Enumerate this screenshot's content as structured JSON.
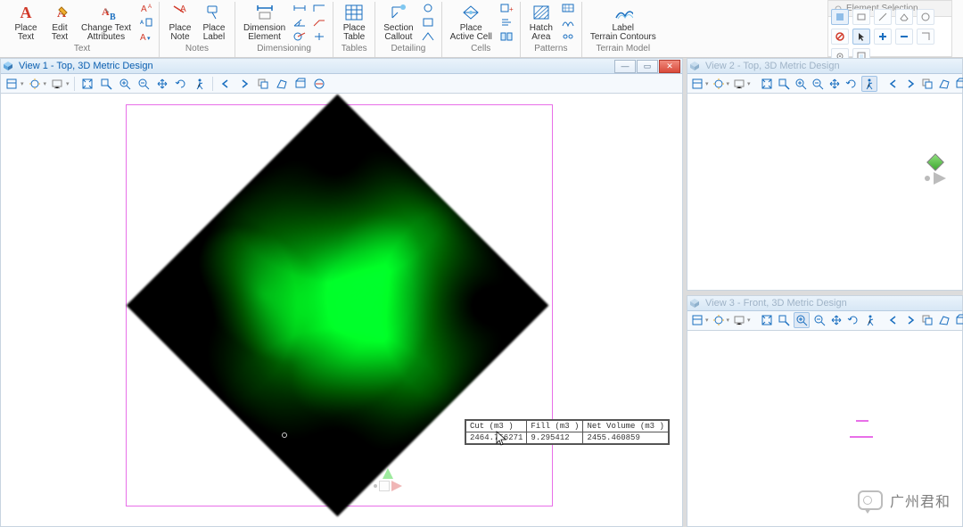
{
  "ribbon": {
    "groups": [
      {
        "label": "Text",
        "buttons": [
          {
            "name": "place-text",
            "label": "Place\nText",
            "icon": "text-A-red"
          },
          {
            "name": "edit-text",
            "label": "Edit\nText",
            "icon": "text-pencil"
          },
          {
            "name": "change-text-attributes",
            "label": "Change Text\nAttributes",
            "icon": "text-swap"
          }
        ],
        "minis": [
          "superscript-icon",
          "text-style-icon",
          "text-case-icon"
        ]
      },
      {
        "label": "Notes",
        "buttons": [
          {
            "name": "place-note",
            "label": "Place\nNote",
            "icon": "note-arrow"
          },
          {
            "name": "place-label",
            "label": "Place\nLabel",
            "icon": "label-tag"
          }
        ]
      },
      {
        "label": "Dimensioning",
        "buttons": [
          {
            "name": "dimension-element",
            "label": "Dimension\nElement",
            "icon": "dim-element"
          }
        ],
        "minis": [
          "dim-linear-icon",
          "dim-angle-icon",
          "dim-radius-icon",
          "dim-ordinate-icon",
          "dim-leader-icon",
          "dim-center-icon"
        ]
      },
      {
        "label": "Tables",
        "buttons": [
          {
            "name": "place-table",
            "label": "Place\nTable",
            "icon": "table-grid"
          }
        ]
      },
      {
        "label": "Detailing",
        "buttons": [
          {
            "name": "section-callout",
            "label": "Section\nCallout",
            "icon": "section-callout"
          }
        ],
        "minis": [
          "detail-a-icon",
          "detail-b-icon",
          "detail-c-icon"
        ]
      },
      {
        "label": "Cells",
        "buttons": [
          {
            "name": "place-active-cell",
            "label": "Place\nActive Cell",
            "icon": "place-cell"
          }
        ],
        "minis": [
          "cell-define-icon",
          "cell-replace-icon",
          "cell-lib-icon"
        ]
      },
      {
        "label": "Patterns",
        "buttons": [
          {
            "name": "hatch-area",
            "label": "Hatch\nArea",
            "icon": "hatch"
          }
        ],
        "minis": [
          "pattern-a-icon",
          "pattern-b-icon",
          "pattern-c-icon"
        ]
      },
      {
        "label": "Terrain Model",
        "buttons": [
          {
            "name": "label-terrain-contours",
            "label": "Label\nTerrain Contours",
            "icon": "terrain-contours"
          }
        ]
      }
    ]
  },
  "palette": {
    "title": "Element Selection",
    "buttons": [
      "select-icon",
      "select-rect-icon",
      "select-line-icon",
      "select-shape-icon",
      "select-circle-icon",
      "select-block-icon",
      "select-stop-icon",
      "cursor-icon",
      "add-sel-icon",
      "subtract-sel-icon",
      "invert-sel-icon",
      "sel-options-icon",
      "sel-filter-icon"
    ]
  },
  "views": {
    "view1": {
      "title": "View 1 - Top, 3D Metric Design"
    },
    "view2": {
      "title": "View 2 - Top, 3D Metric Design"
    },
    "view3": {
      "title": "View 3 - Front, 3D Metric Design"
    }
  },
  "toolbar_icons": [
    "view-attrs",
    "view-display",
    "view-presentation",
    "zoom-fit",
    "zoom-window",
    "zoom-in",
    "zoom-out",
    "pan",
    "rotate-view",
    "walk",
    "prev-view",
    "next-view",
    "copy-view",
    "view-perspective",
    "clip-volume",
    "clip-mask"
  ],
  "volume_table": {
    "headers": [
      "Cut (m3 )",
      "Fill (m3 )",
      "Net Volume (m3 )"
    ],
    "row": [
      "2464.756271",
      "9.295412",
      "2455.460859"
    ]
  },
  "watermark": "广州君和"
}
